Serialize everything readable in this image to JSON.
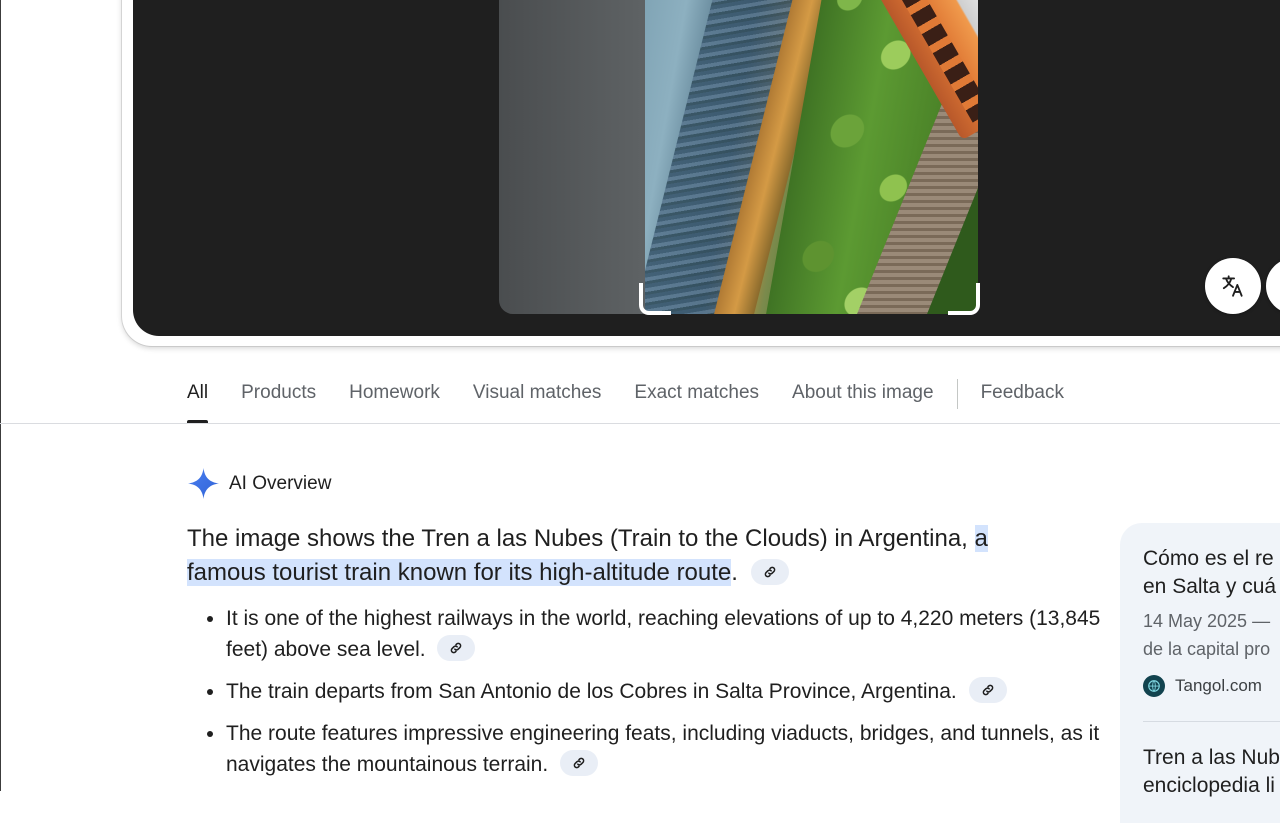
{
  "tabs": [
    {
      "label": "All",
      "active": true
    },
    {
      "label": "Products"
    },
    {
      "label": "Homework"
    },
    {
      "label": "Visual matches"
    },
    {
      "label": "Exact matches"
    },
    {
      "label": "About this image"
    },
    {
      "label": "Feedback"
    }
  ],
  "ai_overview": {
    "label": "AI Overview",
    "summary_text": "The image shows the Tren a las Nubes (Train to the Clouds) in Argentina, ",
    "summary_highlight": "a famous tourist train known for its high-altitude route",
    "summary_end": ".",
    "bullets": [
      "It is one of the highest railways in the world, reaching elevations of up to 4,220 meters (13,845 feet) above sea level.",
      "The train departs from San Antonio de los Cobres in Salta Province, Argentina.",
      "The route features impressive engineering feats, including viaducts, bridges, and tunnels, as it navigates the mountainous terrain."
    ]
  },
  "side_card": {
    "title_line1": "Cómo es el re",
    "title_line2": "en Salta y cuá",
    "snippet_line1": "14 May 2025 —",
    "snippet_line2": "de la capital pro",
    "source": "Tangol.com",
    "second_title_line1": "Tren a las Nub",
    "second_title_line2": "enciclopedia li"
  },
  "icons": {
    "ai": "sparkle-icon",
    "translate": "translate-icon",
    "link": "link-icon"
  },
  "colors": {
    "accent": "#4285f4",
    "highlight": "#d3e3fd",
    "viewer_bg": "#1f1f1f",
    "card_bg": "#f0f4f9"
  }
}
